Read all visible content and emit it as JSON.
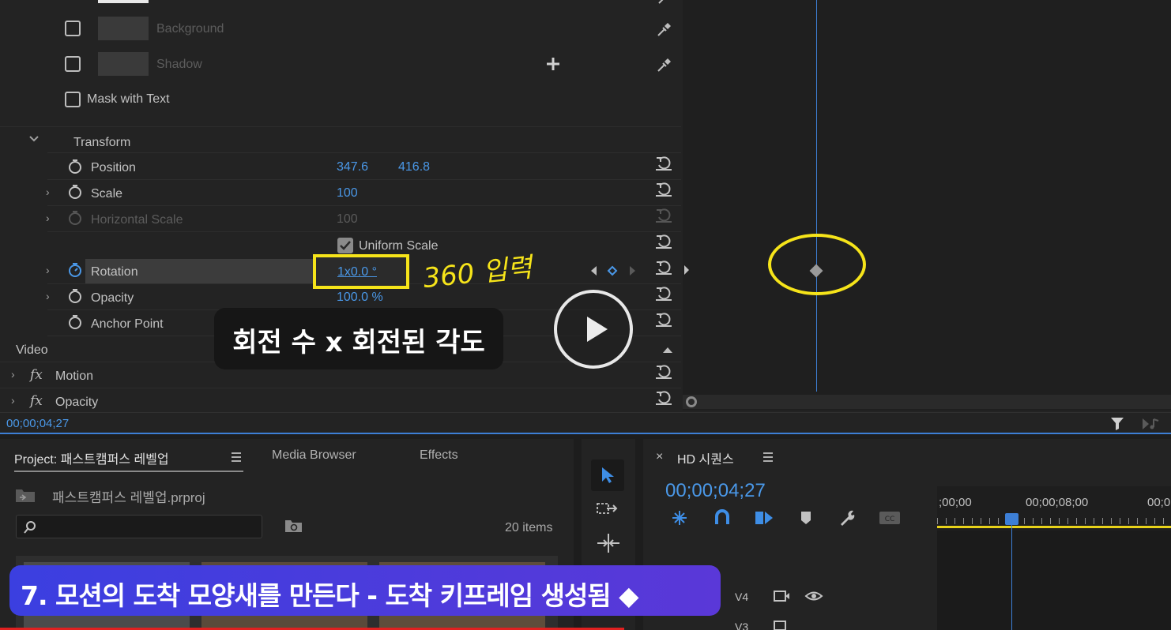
{
  "effect_controls": {
    "rows": {
      "background": "Background",
      "shadow": "Shadow",
      "mask_with_text": "Mask with Text",
      "transform": "Transform",
      "position": {
        "label": "Position",
        "x": "347.6",
        "y": "416.8"
      },
      "scale": {
        "label": "Scale",
        "value": "100"
      },
      "horizontal_scale": {
        "label": "Horizontal Scale",
        "value": "100"
      },
      "uniform_scale": "Uniform Scale",
      "rotation": {
        "label": "Rotation",
        "value": "1x0.0 °"
      },
      "opacity": {
        "label": "Opacity",
        "value": "100.0 %"
      },
      "anchor_point": {
        "label": "Anchor Point"
      },
      "video_header": "Video",
      "motion": "Motion",
      "opacity_fx": "Opacity"
    },
    "timecode": "00;00;04;27",
    "annotation": "360 입력"
  },
  "caption": "회전 수 x 회전된 각도",
  "project": {
    "tabs": [
      "Project: 패스트캠퍼스 레벨업",
      "Media Browser",
      "Effects"
    ],
    "file_name": "패스트캠퍼스 레벨업.prproj",
    "items_count": "20 items"
  },
  "sequence": {
    "title": "HD 시퀀스",
    "timecode": "00;00;04;27",
    "ruler_labels": [
      ";00;00",
      "00;00;08;00",
      "00;0"
    ],
    "tracks": [
      "V4",
      "V3"
    ]
  },
  "banner": "7. 모션의 도착 모양새를 만든다 - 도착 키프레임 생성됨 ◆",
  "colors": {
    "accent_blue": "#4a98e8",
    "annotation_yellow": "#f6e41a",
    "banner_purple": "#3b3fe0"
  }
}
